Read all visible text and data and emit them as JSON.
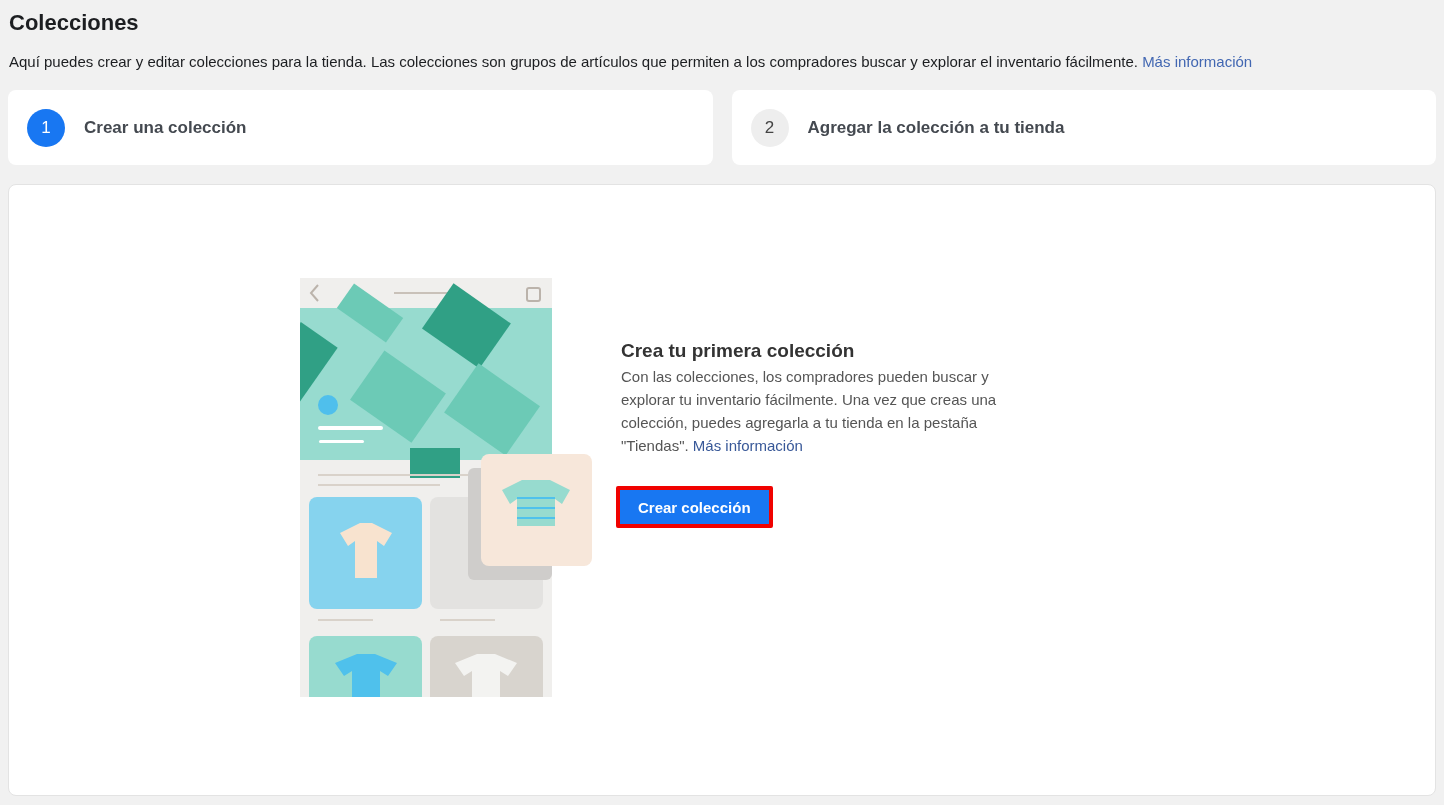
{
  "page": {
    "title": "Colecciones",
    "description": "Aquí puedes crear y editar colecciones para la tienda. Las colecciones son grupos de artículos que permiten a los compradores buscar y explorar el inventario fácilmente.",
    "link": "Más información"
  },
  "steps": [
    {
      "number": "1",
      "label": "Crear una colección",
      "selected": true
    },
    {
      "number": "2",
      "label": "Agregar la colección a tu tienda",
      "selected": false
    }
  ],
  "empty_state": {
    "title": "Crea tu primera colección",
    "text": "Con las colecciones, los compradores pueden buscar y explorar tu inventario fácilmente. Una vez que creas una colección, puedes agregarla a tu tienda en la pestaña \"Tiendas\".",
    "link": "Más información",
    "button": {
      "label": "Crear colección",
      "highlighted": true
    }
  }
}
